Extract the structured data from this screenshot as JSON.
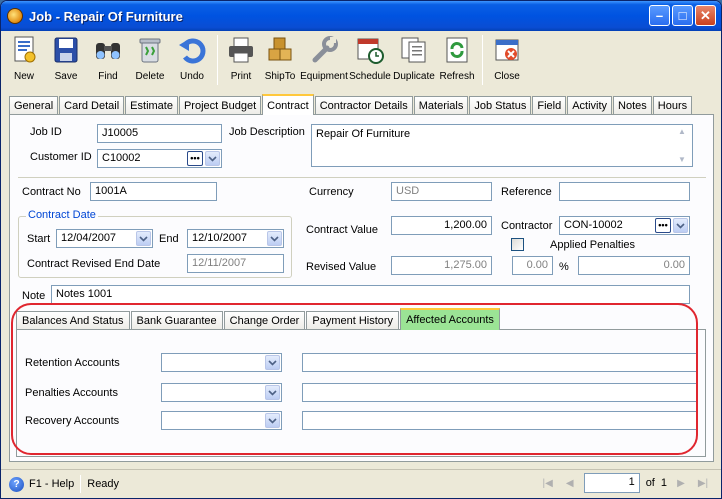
{
  "window": {
    "title": "Job - Repair Of Furniture"
  },
  "toolbar": [
    {
      "id": "new",
      "label": "New",
      "icon": "new-document-icon"
    },
    {
      "id": "save",
      "label": "Save",
      "icon": "floppy-disk-icon"
    },
    {
      "id": "find",
      "label": "Find",
      "icon": "binoculars-icon"
    },
    {
      "id": "delete",
      "label": "Delete",
      "icon": "trash-can-icon"
    },
    {
      "id": "undo",
      "label": "Undo",
      "icon": "undo-arrow-icon"
    },
    {
      "id": "print",
      "label": "Print",
      "icon": "printer-icon"
    },
    {
      "id": "shipto",
      "label": "ShipTo",
      "icon": "shipping-boxes-icon"
    },
    {
      "id": "equipment",
      "label": "Equipment",
      "icon": "wrench-icon"
    },
    {
      "id": "schedule",
      "label": "Schedule",
      "icon": "calendar-clock-icon"
    },
    {
      "id": "duplicate",
      "label": "Duplicate",
      "icon": "duplicate-pages-icon"
    },
    {
      "id": "refresh",
      "label": "Refresh",
      "icon": "refresh-arrows-icon"
    },
    {
      "id": "close",
      "label": "Close",
      "icon": "close-window-icon"
    }
  ],
  "main_tabs": [
    "General",
    "Card Detail",
    "Estimate",
    "Project Budget",
    "Contract",
    "Contractor Details",
    "Materials",
    "Job Status",
    "Field",
    "Activity",
    "Notes",
    "Hours"
  ],
  "main_tab_active": "Contract",
  "form": {
    "job_id_label": "Job ID",
    "job_id": "J10005",
    "customer_id_label": "Customer ID",
    "customer_id": "C10002",
    "job_description_label": "Job Description",
    "job_description": "Repair Of Furniture",
    "contract_no_label": "Contract No",
    "contract_no": "1001A",
    "currency_label": "Currency",
    "currency": "USD",
    "reference_label": "Reference",
    "reference": "",
    "contract_date_group": "Contract Date",
    "start_label": "Start",
    "start": "12/04/2007",
    "end_label": "End",
    "end": "12/10/2007",
    "revised_end_label": "Contract Revised End Date",
    "revised_end": "12/11/2007",
    "contract_value_label": "Contract Value",
    "contract_value": "1,200.00",
    "contractor_label": "Contractor",
    "contractor": "CON-10002",
    "applied_penalties_label": "Applied Penalties",
    "revised_value_label": "Revised Value",
    "revised_value": "1,275.00",
    "penalty_amount": "0.00",
    "percent_label": "%",
    "penalty_percent": "0.00",
    "note_label": "Note",
    "note": "Notes 1001"
  },
  "inner_tabs": [
    "Balances And Status",
    "Bank Guarantee",
    "Change Order",
    "Payment History",
    "Affected Accounts"
  ],
  "inner_tab_active": "Affected Accounts",
  "accounts": [
    {
      "label": "Retention Accounts",
      "account": "",
      "description": ""
    },
    {
      "label": "Penalties Accounts",
      "account": "",
      "description": ""
    },
    {
      "label": "Recovery Accounts",
      "account": "",
      "description": ""
    }
  ],
  "status": {
    "help": "F1 - Help",
    "state": "Ready",
    "page": "1",
    "of_label": "of",
    "total": "1"
  }
}
